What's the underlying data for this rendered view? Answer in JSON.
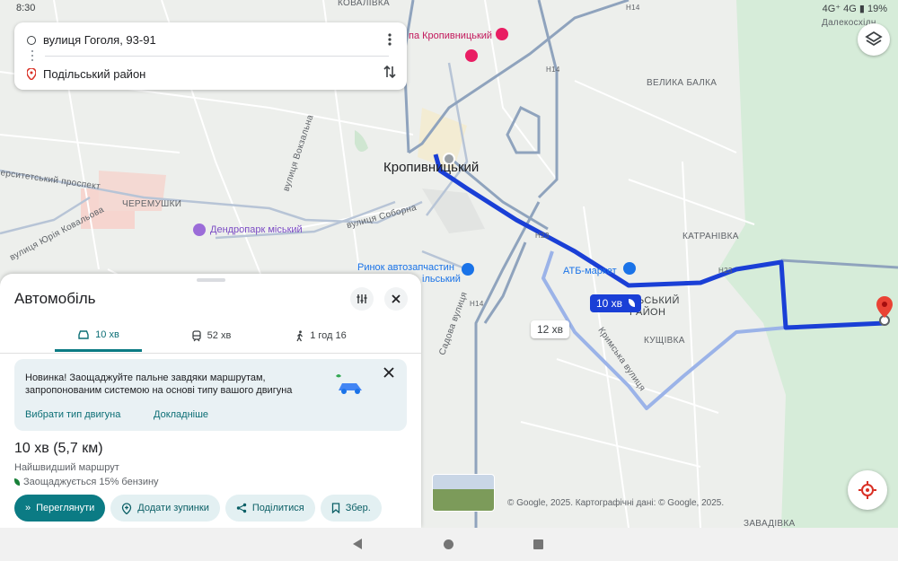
{
  "status": {
    "time": "8:30",
    "right": "4G⁺ 4G ▮ 19%"
  },
  "search": {
    "origin": "вулиця Гоголя, 93-91",
    "destination": "Подільський район",
    "more_icon": "more-vert-icon",
    "swap_icon": "swap-vert-icon"
  },
  "map": {
    "city": "Кропивницький",
    "labels": {
      "velyka_balka": "ВЕЛИКА БАЛКА",
      "katranivka": "КАТРАНІВКА",
      "kushchivka": "КУЩІВКА",
      "zavadivka": "ЗАВАДІВКА",
      "cheremushky": "ЧЕРЕМУШКИ",
      "podilskyi": "ЬСЬКИЙ",
      "raion": "РАЙОН",
      "prospekt": "ерситетський проспект",
      "kovalenka": "вулиця Юрія Ковальова",
      "vokzalna": "вулиця Вокзальна",
      "soborna": "вулиця Соборна",
      "sadova": "Садова вулиця",
      "krymska": "Кримська вулиця",
      "kovalivka": "КОВАЛІВКА",
      "dalekoskhid": "Далекосхідн",
      "h14_top": "H14",
      "h14_mid": "H14",
      "h14_low": "H14",
      "h23_a": "H23",
      "h23_b": "H23"
    },
    "pois": {
      "hotel": "па Кропивницький",
      "dendropark": "Дендропарк міський",
      "rynok": "Ринок автозапчастин",
      "rynok2": "ільський",
      "atb": "АТБ-маркет"
    },
    "primary_time": "10 хв",
    "alt_time": "12 хв",
    "copyright": "© Google, 2025. Картографічні дані: © Google, 2025."
  },
  "panel": {
    "title": "Автомобіль",
    "tabs": [
      {
        "label": "10 хв",
        "icon": "car-icon",
        "active": true
      },
      {
        "label": "52 хв",
        "icon": "train-icon",
        "active": false
      },
      {
        "label": "1 год 16",
        "icon": "walk-icon",
        "active": false
      }
    ],
    "promo": {
      "text": "Новинка! Заощаджуйте пальне завдяки маршрутам, запропонованим системою на основі типу вашого двигуна",
      "link1": "Вибрати тип двигуна",
      "link2": "Докладніше"
    },
    "duration": "10 хв (5,7 км)",
    "route_desc": "Найшвидший маршрут",
    "fuel_saving": "Заощаджується 15% бензину",
    "actions": {
      "preview": "Переглянути",
      "add_stops": "Додати зупинки",
      "share": "Поділитися",
      "save": "Збер."
    }
  },
  "colors": {
    "route": "#1a3fd6",
    "accent": "#0b7b84",
    "park": "#d6ecd9"
  }
}
